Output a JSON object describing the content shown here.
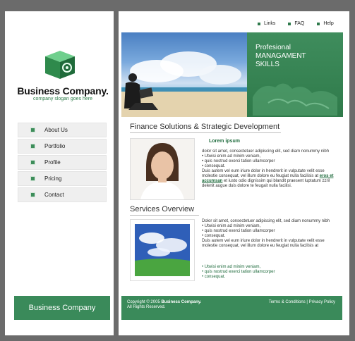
{
  "brand": {
    "name": "Business Company.",
    "slogan": "company slogan goes here"
  },
  "nav": [
    {
      "label": "About Us"
    },
    {
      "label": "Portfolio"
    },
    {
      "label": "Profile"
    },
    {
      "label": "Pricing"
    },
    {
      "label": "Contact"
    }
  ],
  "left_footer": {
    "label": "Business Company"
  },
  "top_links": [
    {
      "label": "Links"
    },
    {
      "label": "FAQ"
    },
    {
      "label": "Help"
    }
  ],
  "banner": {
    "line1": "Profesional",
    "line2": "MANAGAMENT",
    "line3": "SKILLS"
  },
  "section1": {
    "title": "Finance Solutions & Strategic Development",
    "subtitle": "Lorem ipsum",
    "para1": "dolor sit amet, consectetuer adipiscing elit, sed diam nonummy nibh",
    "bullets": [
      "Utwisi enim ad minim veniam,",
      "quis nostrud exerci tation ullamcorper",
      "consequat."
    ],
    "para2_a": "Duis autem vel eum iriure dolor in hendrerit in vulputate velit esse molestie consequat, vel illum dolore eu feugiat nulla facilisis at",
    "para2_link": "eros et accumsan",
    "para2_b": "et iusto odio dignissim qui blandit praesent luptatum zzril delenit augue duis dolore te feugait nulla facilisi."
  },
  "section2": {
    "title": "Services Overview",
    "para1": "Dolor sit amet, consectetuer adipiscing elit, sed diam nonummy nibh",
    "bullets": [
      "Utwisi enim ad minim veniam,",
      "quis nostrud exerci tation ullamcorper",
      "consequat."
    ],
    "para2": "Duis autem vel eum iriure dolor in hendrerit in vulputate velit esse molestie consequat, vel illum dolore eu feugiat nulla facilisis at",
    "green_bullets": [
      "Utwisi enim ad minim veniam,",
      "quis nostrud exerci tation ullamcorper",
      "consequat."
    ]
  },
  "footer": {
    "copy_prefix": "Copyright © 2005",
    "copy_company": "Business Company.",
    "rights": "All Rights Reserved.",
    "terms": "Terms & Conditions",
    "separator": "|",
    "privacy": "Privacy Policy"
  },
  "colors": {
    "accent": "#3a8a5a",
    "frame": "#6b6b6b"
  }
}
